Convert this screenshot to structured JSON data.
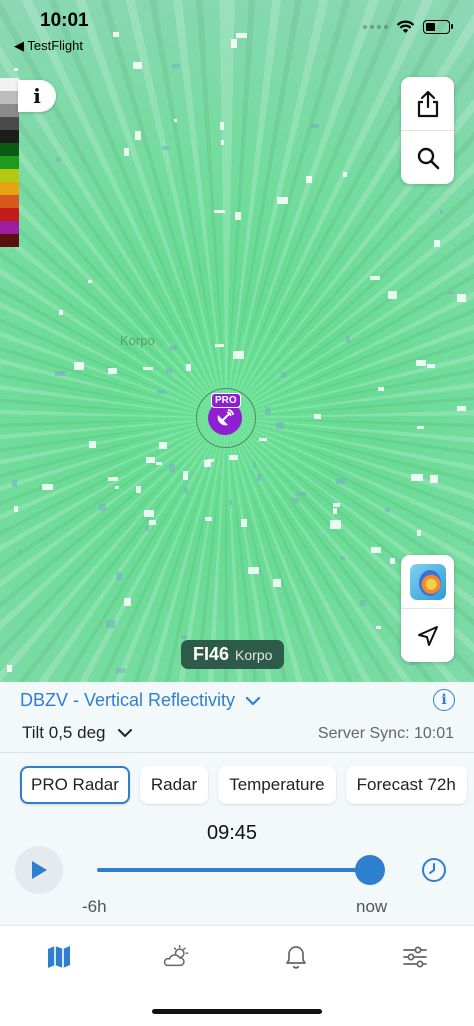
{
  "status_bar": {
    "time": "10:01",
    "back_label": "◀ TestFlight"
  },
  "map": {
    "place_label": "Korpo",
    "info_label": "i",
    "legend_colors": [
      "#f2f2f2",
      "#bdbdbd",
      "#8a8a8a",
      "#4a4a4a",
      "#1c1c1c",
      "#0a5a14",
      "#1f9a1f",
      "#b5c912",
      "#e3a312",
      "#d8581e",
      "#c51a1a",
      "#9c1e9e",
      "#5a1010"
    ],
    "radar_station": {
      "badge": "PRO",
      "code": "FI46",
      "name": "Korpo"
    },
    "buttons": {
      "share": "share-icon",
      "search": "search-icon",
      "layers": "map-layer-icon",
      "locate": "location-arrow-icon"
    }
  },
  "panel": {
    "product": "DBZV - Vertical Reflectivity",
    "tilt": "Tilt 0,5 deg",
    "server_sync": "Server Sync: 10:01",
    "chips": [
      "PRO Radar",
      "Radar",
      "Temperature",
      "Forecast 72h"
    ],
    "active_chip": 0,
    "current_time": "09:45",
    "timeline": {
      "start_label": "-6h",
      "end_label": "now",
      "progress": 1.0
    }
  },
  "tab_bar": {
    "tabs": [
      "map-icon",
      "weather-icon",
      "bell-icon",
      "settings-sliders-icon"
    ],
    "active": 0
  },
  "colors": {
    "accent": "#2f7fd1",
    "pro_purple": "#8f1fd1",
    "station_label_bg": "#2e5a4a"
  }
}
